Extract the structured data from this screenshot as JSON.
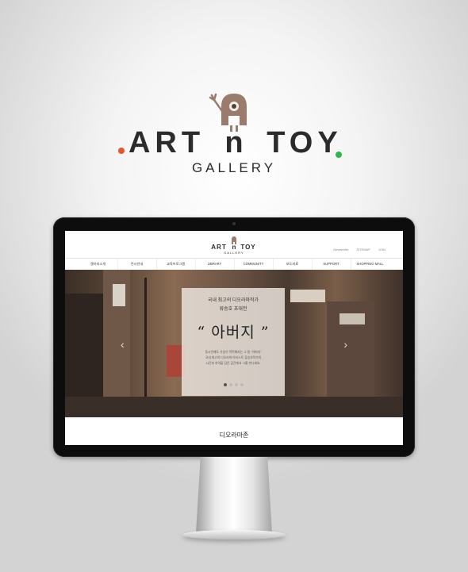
{
  "brand": {
    "word_left": "ART",
    "word_middle": "n",
    "word_right": "TOY",
    "subtitle": "GALLERY",
    "colors": {
      "text": "#2b2b2b",
      "mascot": "#9b7b6b",
      "dot_orange": "#e8552a",
      "dot_green": "#2db84a"
    }
  },
  "website": {
    "logo": {
      "word_left": "ART",
      "word_middle": "n",
      "word_right": "TOY",
      "subtitle": "GALLERY"
    },
    "top_links": [
      "Newsletter",
      "SITEMAP",
      "JOIN"
    ],
    "nav": [
      "갤러리소개",
      "전시안내",
      "교육프로그램",
      "LIBRARY",
      "COMMUNITY",
      "보도자료",
      "SUPPORT",
      "SHOPPING MALL"
    ],
    "hero": {
      "line1": "국내 최고의 디오라마작가",
      "line2": "류승호 초대전",
      "title": "“ 아버지 ”",
      "description": [
        "동시언제도 가슴이 먹먹해지는 그 말 \"아버지\"",
        "국내 최고의 디오라마 아티스트 류승호작가의",
        "시간과 추억을 담은 공간에서 그를 만나세요."
      ],
      "dots": 4,
      "active_dot": 1,
      "prev_icon": "chevron-left-icon",
      "next_icon": "chevron-right-icon"
    },
    "section_title": "디오라마존"
  }
}
